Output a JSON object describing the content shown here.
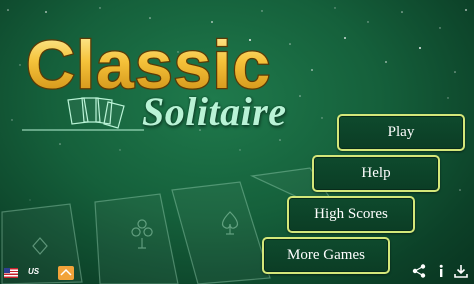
{
  "title": {
    "main": "Classic",
    "sub": "Solitaire"
  },
  "menu": {
    "play": "Play",
    "help": "Help",
    "high_scores": "High Scores",
    "more_games": "More Games"
  },
  "footer": {
    "region": "US",
    "share_icon": "share-icon",
    "info_icon": "info-icon",
    "download_icon": "download-icon"
  },
  "colors": {
    "felt": "#15603b",
    "button_border": "#d4e77a",
    "title_gold": "#f5c23a",
    "subtitle": "#b9f3d6"
  }
}
